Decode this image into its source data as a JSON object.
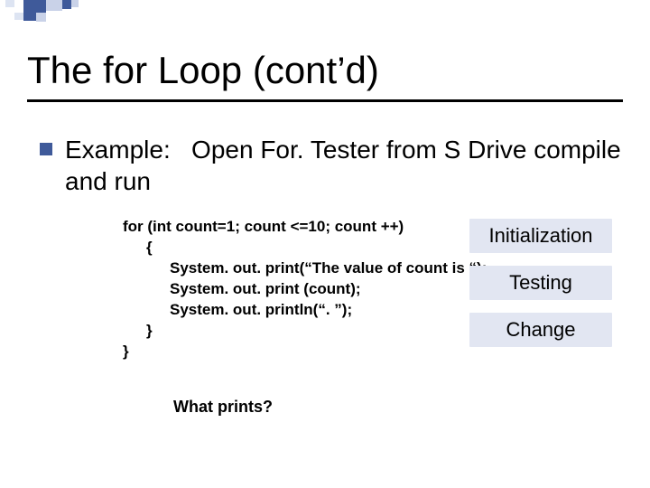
{
  "title": "The for Loop (cont’d)",
  "bullet": "Example:   Open For. Tester from S Drive compile and run",
  "code": {
    "line1": "for (int count=1;  count <=10;  count ++)",
    "brace_open": "{",
    "line2": "System. out. print(“The value of count is “);",
    "line3": "System. out. print (count);",
    "line4": "System. out. println(“. ”);",
    "brace_close_inner": "}",
    "brace_close_outer": "}"
  },
  "labels": {
    "init": "Initialization",
    "test": "Testing",
    "change": "Change"
  },
  "question": "What prints?"
}
